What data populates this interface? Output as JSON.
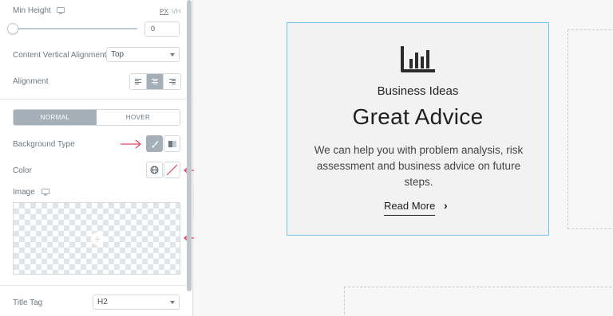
{
  "panel": {
    "min_height": {
      "label": "Min Height",
      "device_icon": "desktop-icon",
      "units": [
        "PX",
        "VH"
      ],
      "value": "0"
    },
    "vertical_alignment": {
      "label": "Content Vertical Alignment",
      "value": "Top"
    },
    "alignment": {
      "label": "Alignment",
      "options": [
        "align-left",
        "align-center",
        "align-right"
      ],
      "selected": "align-center"
    },
    "tabs": [
      {
        "label": "NORMAL",
        "active": true
      },
      {
        "label": "HOVER",
        "active": false
      }
    ],
    "background_type": {
      "label": "Background Type",
      "options": [
        "brush-icon",
        "gradient-icon"
      ],
      "selected": "brush-icon"
    },
    "color": {
      "label": "Color",
      "icons": [
        "globe-icon",
        "no-color-swatch"
      ]
    },
    "image": {
      "label": "Image",
      "device_icon": "desktop-icon"
    },
    "title_tag": {
      "label": "Title Tag",
      "value": "H2"
    },
    "annotation_color": "#e2496a"
  },
  "card": {
    "icon": "bar-chart-icon",
    "subtitle": "Business Ideas",
    "title": "Great Advice",
    "description": "We can help you with problem analysis, risk assessment and business advice on future steps.",
    "link": "Read More",
    "border_color": "#6ec1e4"
  }
}
